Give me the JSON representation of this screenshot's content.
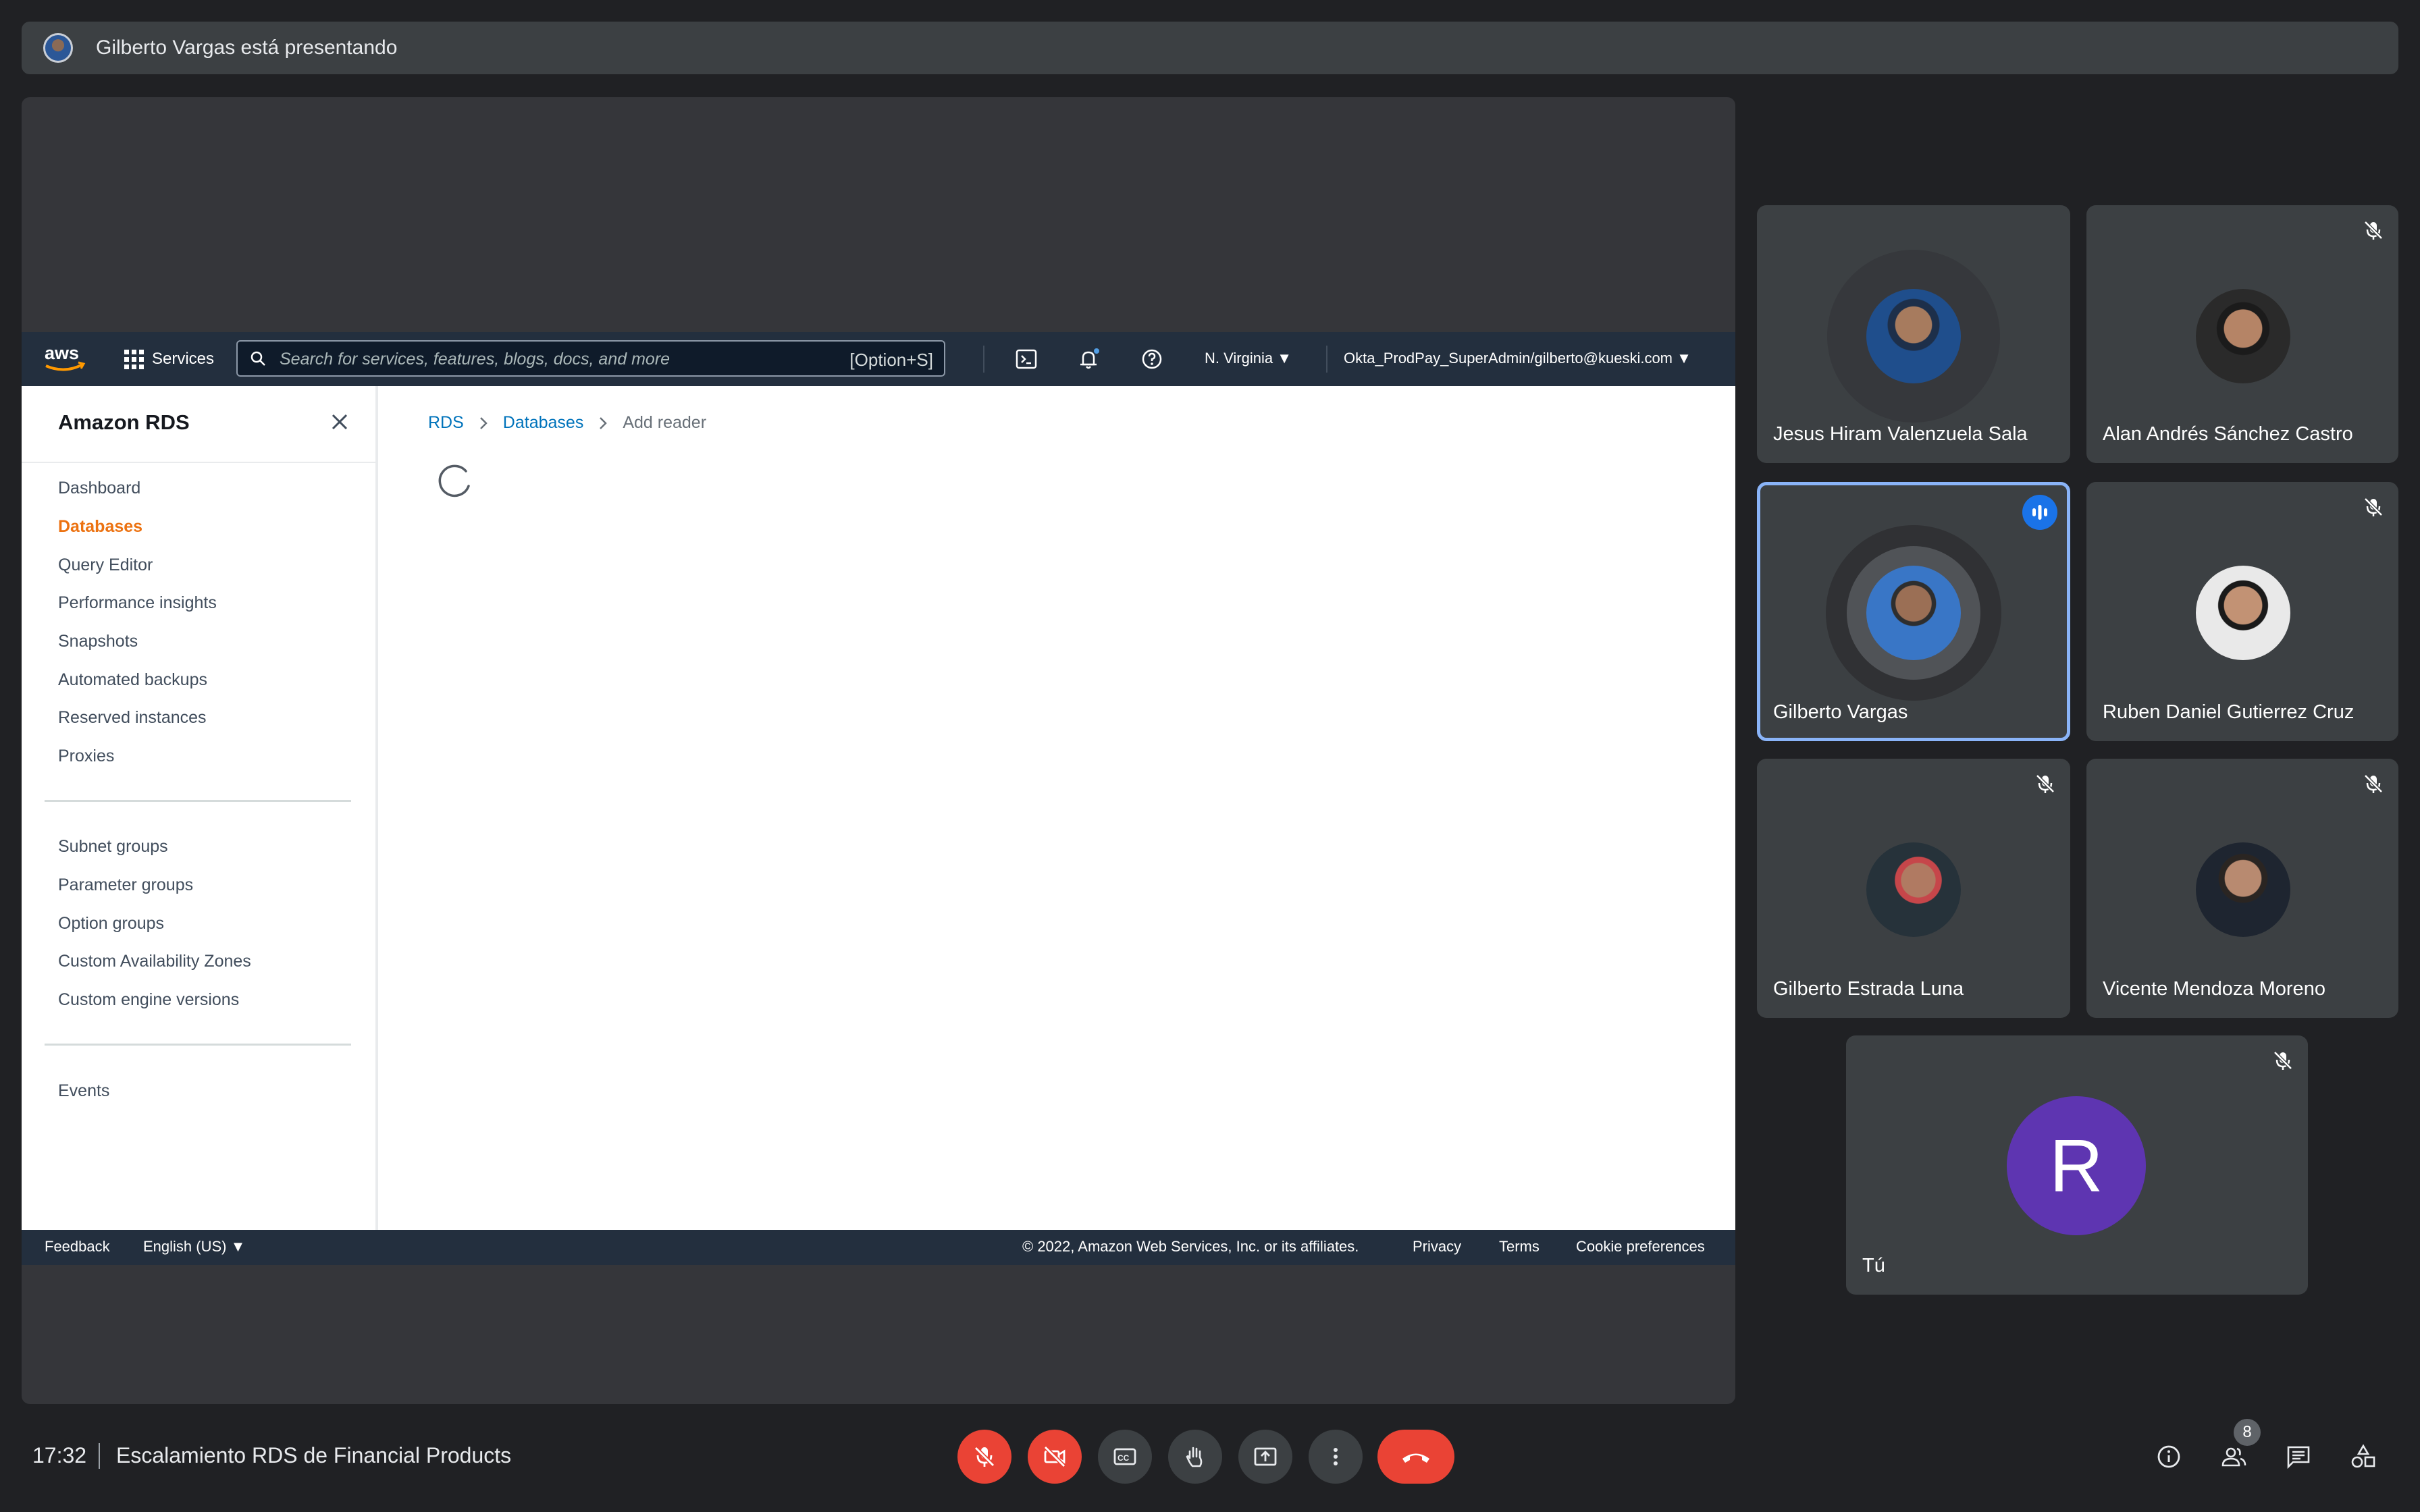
{
  "presenter_bar": {
    "text": "Gilberto Vargas está presentando"
  },
  "aws": {
    "logo_text": "aws",
    "nav": {
      "services_label": "Services",
      "search_placeholder": "Search for services, features, blogs, docs, and more",
      "search_shortcut": "[Option+S]",
      "region": "N. Virginia",
      "account": "Okta_ProdPay_SuperAdmin/gilberto@kueski.com"
    },
    "sidenav": {
      "title": "Amazon RDS",
      "items": [
        {
          "label": "Dashboard",
          "active": false
        },
        {
          "label": "Databases",
          "active": true
        },
        {
          "label": "Query Editor",
          "active": false
        },
        {
          "label": "Performance insights",
          "active": false
        },
        {
          "label": "Snapshots",
          "active": false
        },
        {
          "label": "Automated backups",
          "active": false
        },
        {
          "label": "Reserved instances",
          "active": false
        },
        {
          "label": "Proxies",
          "active": false
        }
      ],
      "items2": [
        {
          "label": "Subnet groups"
        },
        {
          "label": "Parameter groups"
        },
        {
          "label": "Option groups"
        },
        {
          "label": "Custom Availability Zones"
        },
        {
          "label": "Custom engine versions"
        }
      ],
      "items3": [
        {
          "label": "Events"
        }
      ]
    },
    "breadcrumb": [
      "RDS",
      "Databases",
      "Add reader"
    ],
    "footer": {
      "feedback": "Feedback",
      "language": "English (US)",
      "copyright": "© 2022, Amazon Web Services, Inc. or its affiliates.",
      "privacy": "Privacy",
      "terms": "Terms",
      "cookie": "Cookie preferences"
    }
  },
  "participants": [
    {
      "name": "Jesus Hiram Valenzuela Sala",
      "muted": false,
      "speaking": false
    },
    {
      "name": "Alan Andrés Sánchez Castro",
      "muted": true,
      "speaking": false
    },
    {
      "name": "Gilberto Vargas",
      "muted": false,
      "speaking": true
    },
    {
      "name": "Ruben Daniel Gutierrez Cruz",
      "muted": true,
      "speaking": false
    },
    {
      "name": "Gilberto Estrada Luna",
      "muted": true,
      "speaking": false
    },
    {
      "name": "Vicente Mendoza Moreno",
      "muted": true,
      "speaking": false
    },
    {
      "name": "Tú",
      "muted": true,
      "speaking": false,
      "initial": "R",
      "avatar_color": "#5e35b1"
    }
  ],
  "bottom_bar": {
    "time": "17:32",
    "meeting_title": "Escalamiento RDS de Financial Products",
    "controls": [
      "mic-off-icon",
      "camera-off-icon",
      "captions-icon",
      "raise-hand-icon",
      "present-icon",
      "more-options-icon",
      "end-call-icon"
    ],
    "people_count": "8"
  }
}
